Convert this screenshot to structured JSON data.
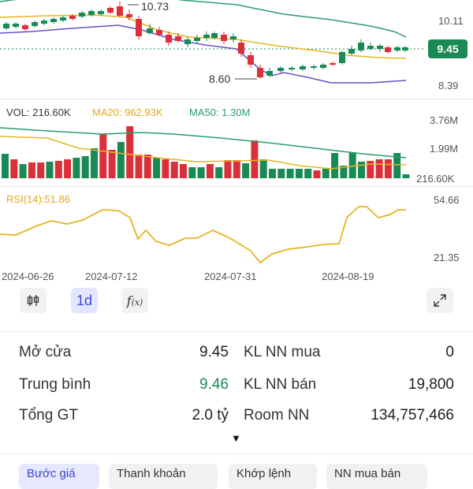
{
  "price_chart": {
    "high_label": "10.73",
    "low_label": "8.60",
    "axis": [
      "10.11",
      "8.39"
    ],
    "current_price": "9.45"
  },
  "volume_chart": {
    "legend_vol": "VOL: 216.60K",
    "legend_ma20": "MA20: 962.93K",
    "legend_ma50": "MA50: 1.30M",
    "axis": [
      "3.76M",
      "1.99M",
      "216.60K"
    ]
  },
  "rsi_chart": {
    "legend": "RSI(14):51.86",
    "axis": [
      "54.66",
      "21.35"
    ]
  },
  "dates": [
    "2024-06-26",
    "2024-07-12",
    "2024-07-31",
    "2024-08-19"
  ],
  "toolbar": {
    "interval_label": "1d"
  },
  "stats": {
    "open_label": "Mở cửa",
    "open_value": "9.45",
    "avg_label": "Trung bình",
    "avg_value": "9.46",
    "total_label": "Tổng GT",
    "total_value": "2.0 tỷ",
    "nn_buy_label": "KL NN mua",
    "nn_buy_value": "0",
    "nn_sell_label": "KL NN bán",
    "nn_sell_value": "19,800",
    "room_label": "Room NN",
    "room_value": "134,757,466"
  },
  "tabs": [
    "Bước giá",
    "Thanh khoản",
    "Khớp lệnh",
    "NN mua bán"
  ],
  "colors": {
    "up": "#1a8a55",
    "down": "#d9303a",
    "ma20": "#e6b422",
    "ma50": "#2a9d6f",
    "band_low": "#6b4fc8",
    "rsi": "#e6b422"
  }
}
